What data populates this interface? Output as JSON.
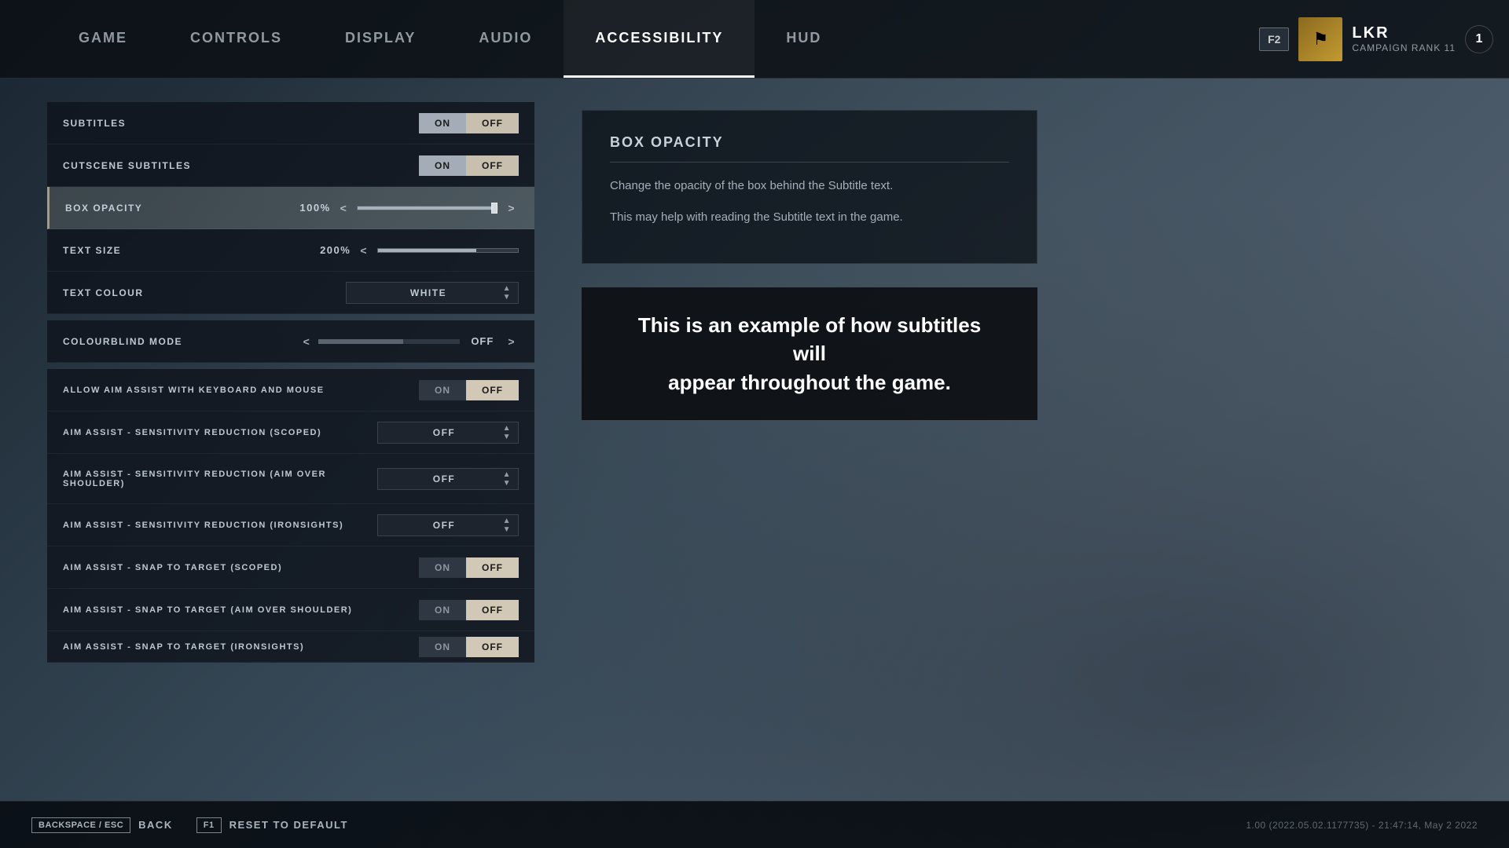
{
  "background": {
    "color_from": "#1a2530",
    "color_to": "#5a6a7a"
  },
  "nav": {
    "tabs": [
      {
        "id": "game",
        "label": "GAME",
        "active": false
      },
      {
        "id": "controls",
        "label": "CONTROLS",
        "active": false
      },
      {
        "id": "display",
        "label": "DISPLAY",
        "active": false
      },
      {
        "id": "audio",
        "label": "AUDIO",
        "active": false
      },
      {
        "id": "accessibility",
        "label": "ACCESSIBILITY",
        "active": true
      },
      {
        "id": "hud",
        "label": "HUD",
        "active": false
      }
    ]
  },
  "user": {
    "f2_label": "F2",
    "avatar_icon": "⚑",
    "name": "LKR",
    "rank_label": "CAMPAIGN RANK 11",
    "rank_number": "1"
  },
  "settings": {
    "subtitles": {
      "label": "SUBTITLES",
      "on_label": "ON",
      "off_label": "OFF",
      "value": "ON"
    },
    "cutscene_subtitles": {
      "label": "CUTSCENE SUBTITLES",
      "on_label": "ON",
      "off_label": "OFF",
      "value": "ON"
    },
    "box_opacity": {
      "label": "BOX OPACITY",
      "value": "100%",
      "fill_percent": 100,
      "left_arrow": "<",
      "right_arrow": ">"
    },
    "text_size": {
      "label": "TEXT SIZE",
      "value": "200%",
      "fill_percent": 70,
      "left_arrow": "<"
    },
    "text_colour": {
      "label": "TEXT COLOUR",
      "value": "WHITE"
    },
    "colourblind_mode": {
      "label": "COLOURBLIND MODE",
      "value": "OFF",
      "left_arrow": "<",
      "right_arrow": ">"
    },
    "allow_aim_assist": {
      "label": "ALLOW AIM ASSIST WITH KEYBOARD AND MOUSE",
      "on_label": "ON",
      "off_label": "OFF",
      "value": "OFF"
    },
    "aim_sensitivity_scoped": {
      "label": "AIM ASSIST - SENSITIVITY REDUCTION (SCOPED)",
      "value": "OFF"
    },
    "aim_sensitivity_aim_over": {
      "label": "AIM ASSIST - SENSITIVITY REDUCTION (AIM OVER SHOULDER)",
      "value": "OFF"
    },
    "aim_sensitivity_ironsights": {
      "label": "AIM ASSIST - SENSITIVITY REDUCTION (IRONSIGHTS)",
      "value": "OFF"
    },
    "aim_snap_scoped": {
      "label": "AIM ASSIST - SNAP TO TARGET (SCOPED)",
      "on_label": "ON",
      "off_label": "OFF",
      "value": "OFF"
    },
    "aim_snap_aim_over": {
      "label": "AIM ASSIST - SNAP TO TARGET (AIM OVER SHOULDER)",
      "on_label": "ON",
      "off_label": "OFF",
      "value": "OFF"
    },
    "aim_snap_ironsights": {
      "label": "AIM ASSIST - SNAP TO TARGET (IRONSIGHTS)",
      "on_label": "ON",
      "off_label": "OFF",
      "value": "OFF"
    }
  },
  "info_panel": {
    "title": "BOX OPACITY",
    "description1": "Change the opacity of the box behind the Subtitle text.",
    "description2": "This may help with reading the Subtitle text in the game.",
    "subtitle_example": "This is an example of how subtitles will\nappear throughout the game."
  },
  "bottom_bar": {
    "back_key": "BACKSPACE / ESC",
    "back_label": "BACK",
    "reset_key": "F1",
    "reset_label": "RESET TO DEFAULT",
    "version": "1.00 (2022.05.02.1177735) - 21:47:14, May  2 2022"
  }
}
